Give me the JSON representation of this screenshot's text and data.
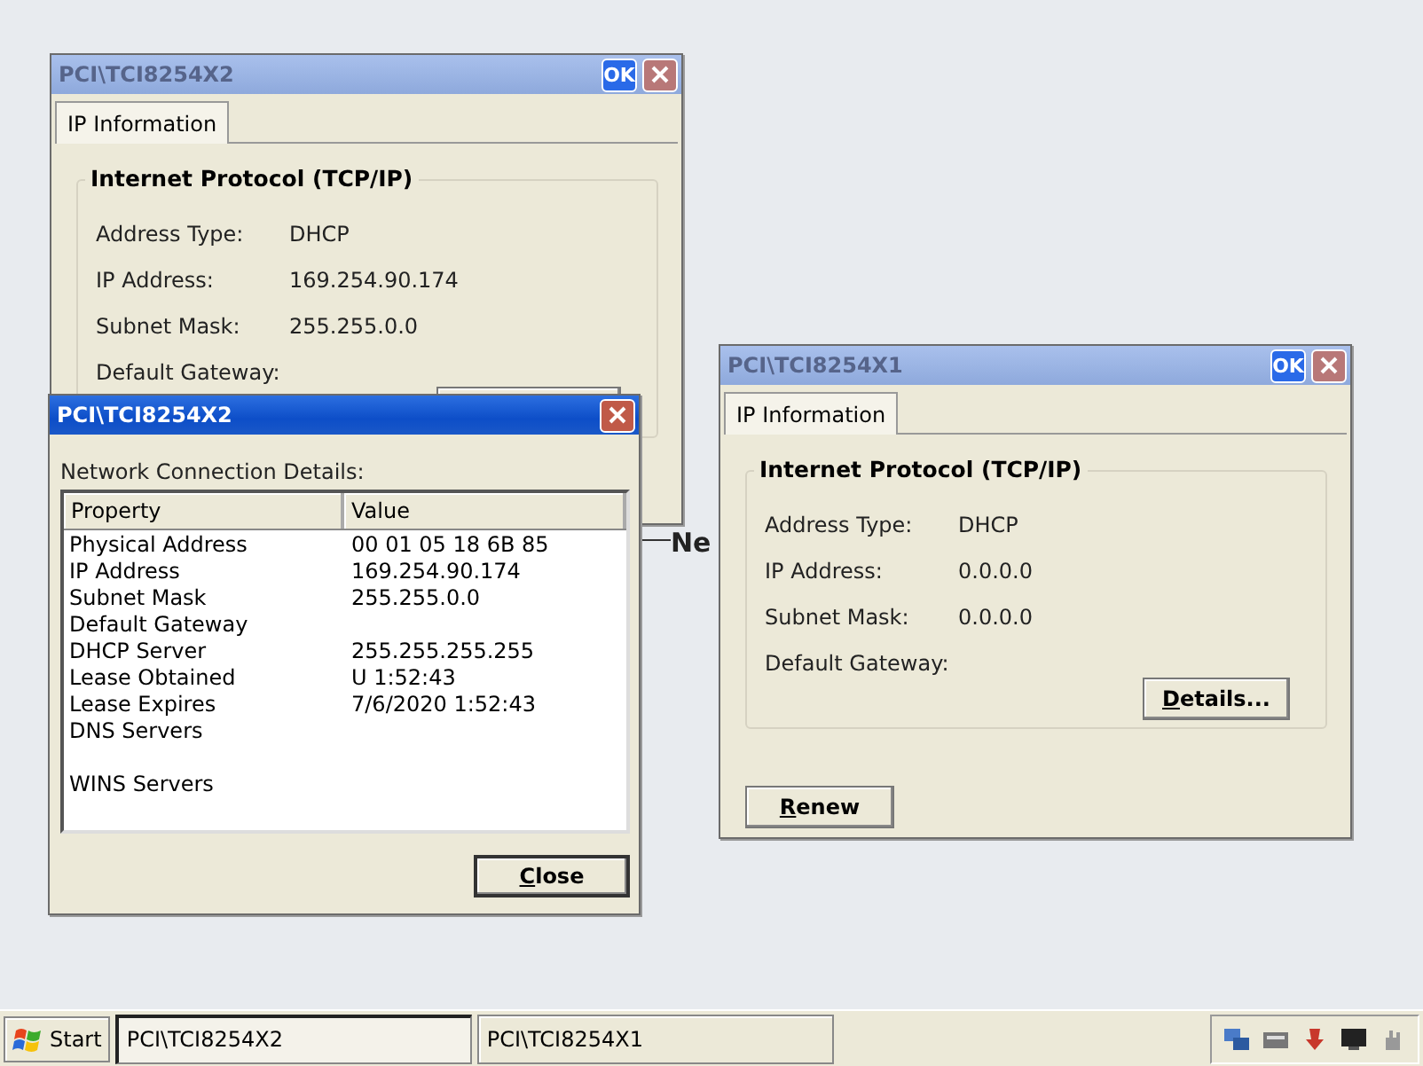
{
  "desktop": {
    "label": "Ne"
  },
  "windows": [
    {
      "kind": "properties",
      "title": "PCI\\TCI8254X2",
      "active": false,
      "ok_button": "OK",
      "tab": {
        "label": "IP Information",
        "selected": true
      },
      "group_title": "Internet Protocol (TCP/IP)",
      "fields": [
        {
          "label": "Address Type:",
          "value": "DHCP"
        },
        {
          "label": "IP Address:",
          "value": "169.254.90.174"
        },
        {
          "label": "Subnet Mask:",
          "value": "255.255.0.0"
        },
        {
          "label": "Default Gateway:"
        }
      ]
    },
    {
      "kind": "properties",
      "title": "PCI\\TCI8254X1",
      "active": false,
      "ok_button": "OK",
      "tab": {
        "label": "IP Information",
        "selected": true
      },
      "group_title": "Internet Protocol (TCP/IP)",
      "fields": [
        {
          "label": "Address Type:",
          "value": "DHCP"
        },
        {
          "label": "IP Address:",
          "value": "0.0.0.0"
        },
        {
          "label": "Subnet Mask:",
          "value": "0.0.0.0"
        },
        {
          "label": "Default Gateway:"
        }
      ],
      "details_button": "Details...",
      "renew_button": "Renew"
    },
    {
      "kind": "details",
      "title": "PCI\\TCI8254X2",
      "active": true,
      "caption": "Network Connection Details:",
      "columns": [
        "Property",
        "Value"
      ],
      "rows": [
        {
          "property": "Physical Address",
          "value": "00 01 05 18 6B 85"
        },
        {
          "property": "IP Address",
          "value": "169.254.90.174"
        },
        {
          "property": "Subnet Mask",
          "value": "255.255.0.0"
        },
        {
          "property": "Default Gateway"
        },
        {
          "property": "DHCP Server",
          "value": "255.255.255.255"
        },
        {
          "property": "Lease Obtained",
          "value": "U 1:52:43"
        },
        {
          "property": "Lease Expires",
          "value": "7/6/2020 1:52:43"
        },
        {
          "property": "DNS Servers"
        },
        {
          "property": ""
        },
        {
          "property": "WINS Servers"
        }
      ],
      "close_button": "Close"
    }
  ],
  "taskbar": {
    "start": "Start",
    "tasks": [
      {
        "label": "PCI\\TCI8254X2",
        "selected": true
      },
      {
        "label": "PCI\\TCI8254X1",
        "selected": false
      }
    ]
  }
}
